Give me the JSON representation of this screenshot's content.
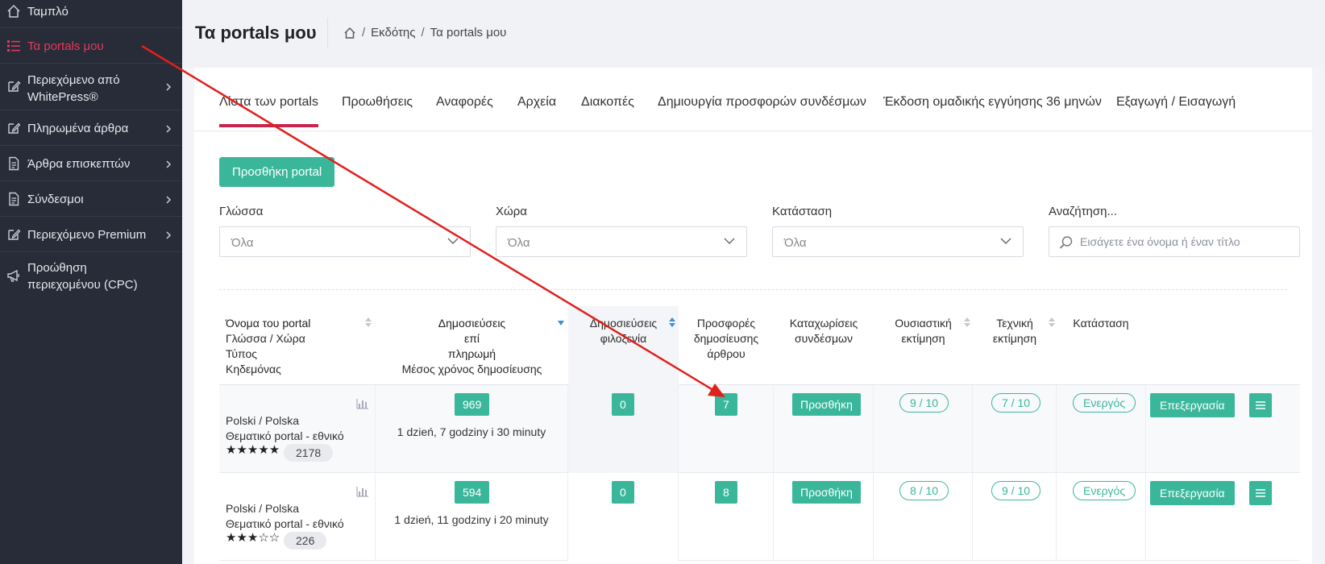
{
  "sidebar": {
    "items": [
      {
        "label": "Ταμπλό",
        "icon": "home-icon",
        "chevron": false
      },
      {
        "label": "Τα portals μου",
        "icon": "list-icon",
        "chevron": false,
        "active": true
      },
      {
        "label": "Περιεχόμενο από WhitePress®",
        "icon": "edit-icon",
        "chevron": true
      },
      {
        "label": "Πληρωμένα άρθρα",
        "icon": "edit-icon",
        "chevron": true
      },
      {
        "label": "Άρθρα επισκεπτών",
        "icon": "document-icon",
        "chevron": true
      },
      {
        "label": "Σύνδεσμοι",
        "icon": "document-icon",
        "chevron": true
      },
      {
        "label": "Περιεχόμενο Premium",
        "icon": "edit-icon",
        "chevron": true
      },
      {
        "label": "Προώθηση περιεχομένου (CPC)",
        "icon": "megaphone-icon",
        "chevron": false
      }
    ]
  },
  "header": {
    "title": "Τα portals μου",
    "breadcrumb": [
      "Εκδότης",
      "Τα portals μου"
    ]
  },
  "tabs": [
    "Λίστα των portals",
    "Προωθήσεις",
    "Αναφορές",
    "Αρχεία",
    "Διακοπές",
    "Δημιουργία προσφορών συνδέσμων",
    "Έκδοση ομαδικής εγγύησης 36 μηνών",
    "Εξαγωγή / Εισαγωγή"
  ],
  "add_button": "Προσθήκη portal",
  "filters": {
    "language": {
      "label": "Γλώσσα",
      "value": "Όλα"
    },
    "country": {
      "label": "Χώρα",
      "value": "Όλα"
    },
    "status": {
      "label": "Κατάσταση",
      "value": "Όλα"
    },
    "search": {
      "label": "Αναζήτηση...",
      "placeholder": "Εισάγετε ένα όνομα ή έναν τίτλο"
    }
  },
  "table": {
    "headers": {
      "portal": [
        "Όνομα του portal",
        "Γλώσσα / Χώρα",
        "Τύπος",
        "Κηδεμόνας"
      ],
      "paid": [
        "Δημοσιεύσεις",
        "επί",
        "πληρωμή",
        "Μέσος χρόνος δημοσίευσης"
      ],
      "hosted": [
        "Δημοσιεύσεις",
        "φιλοξενία"
      ],
      "offers": [
        "Προσφορές",
        "δημοσίευσης",
        "άρθρου"
      ],
      "links": [
        "Καταχωρίσεις",
        "συνδέσμων"
      ],
      "substantive": [
        "Ουσιαστική",
        "εκτίμηση"
      ],
      "technical": [
        "Τεχνική",
        "εκτίμηση"
      ],
      "status": [
        "Κατάσταση"
      ]
    },
    "rows": [
      {
        "lang_country": "Polski / Polska",
        "type": "Θεματικό portal - εθνικό",
        "stars": "★★★★★",
        "rating_count": "2178",
        "paid": "969",
        "avg_time": "1 dzień, 7 godziny i 30 minuty",
        "hosted": "0",
        "offers": "7",
        "links_btn": "Προσθήκη",
        "substantive": "9 / 10",
        "technical": "7 / 10",
        "status": "Ενεργός",
        "edit": "Επεξεργασία"
      },
      {
        "lang_country": "Polski / Polska",
        "type": "Θεματικό portal - εθνικό",
        "stars": "★★★☆☆",
        "rating_count": "226",
        "paid": "594",
        "avg_time": "1 dzień, 11 godziny i 20 minuty",
        "hosted": "0",
        "offers": "8",
        "links_btn": "Προσθήκη",
        "substantive": "8 / 10",
        "technical": "9 / 10",
        "status": "Ενεργός",
        "edit": "Επεξεργασία"
      }
    ]
  },
  "colors": {
    "accent": "#3ab79b",
    "sidebar_bg": "#272c38",
    "active_red": "#e5395b",
    "tab_underline": "#c7254e",
    "annotation_arrow": "#e0201c"
  }
}
